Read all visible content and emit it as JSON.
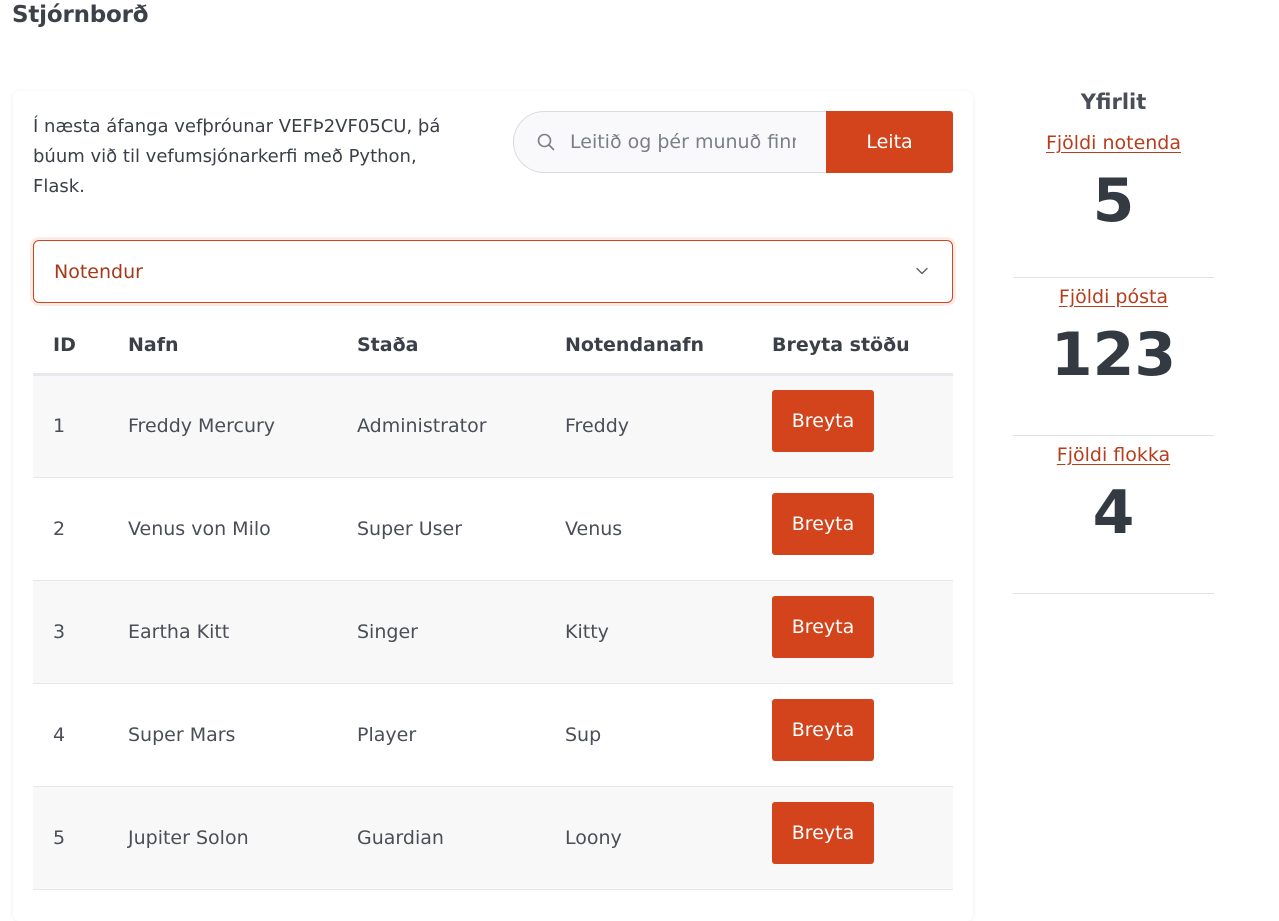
{
  "page": {
    "title": "Stjórnborð"
  },
  "intro": {
    "text": "Í næsta áfanga vefþróunar VEFÞ2VF05CU, þá búum við til vefumsjónarkerfi með Python, Flask."
  },
  "search": {
    "placeholder": "Leitið og þér munuð finna",
    "button_label": "Leita",
    "icon": "search-icon"
  },
  "select": {
    "value": "Notendur",
    "icon": "chevron-down-icon"
  },
  "table": {
    "headers": {
      "id": "ID",
      "name": "Nafn",
      "status": "Staða",
      "username": "Notendanafn",
      "action": "Breyta stöðu"
    },
    "rows": [
      {
        "id": "1",
        "name": "Freddy Mercury",
        "status": "Administrator",
        "username": "Freddy",
        "action": "Breyta"
      },
      {
        "id": "2",
        "name": "Venus von Milo",
        "status": "Super User",
        "username": "Venus",
        "action": "Breyta"
      },
      {
        "id": "3",
        "name": "Eartha Kitt",
        "status": "Singer",
        "username": "Kitty",
        "action": "Breyta"
      },
      {
        "id": "4",
        "name": "Super Mars",
        "status": "Player",
        "username": "Sup",
        "action": "Breyta"
      },
      {
        "id": "5",
        "name": "Jupiter Solon",
        "status": "Guardian",
        "username": "Loony",
        "action": "Breyta"
      }
    ]
  },
  "overview": {
    "title": "Yfirlit",
    "stats": [
      {
        "label": "Fjöldi notenda",
        "value": "5"
      },
      {
        "label": "Fjöldi pósta",
        "value": "123"
      },
      {
        "label": "Fjöldi flokka",
        "value": "4"
      }
    ]
  },
  "colors": {
    "accent": "#d3431c",
    "link": "#b53e1c",
    "text": "#3b3f47",
    "row_stripe": "#f8f8f8"
  }
}
